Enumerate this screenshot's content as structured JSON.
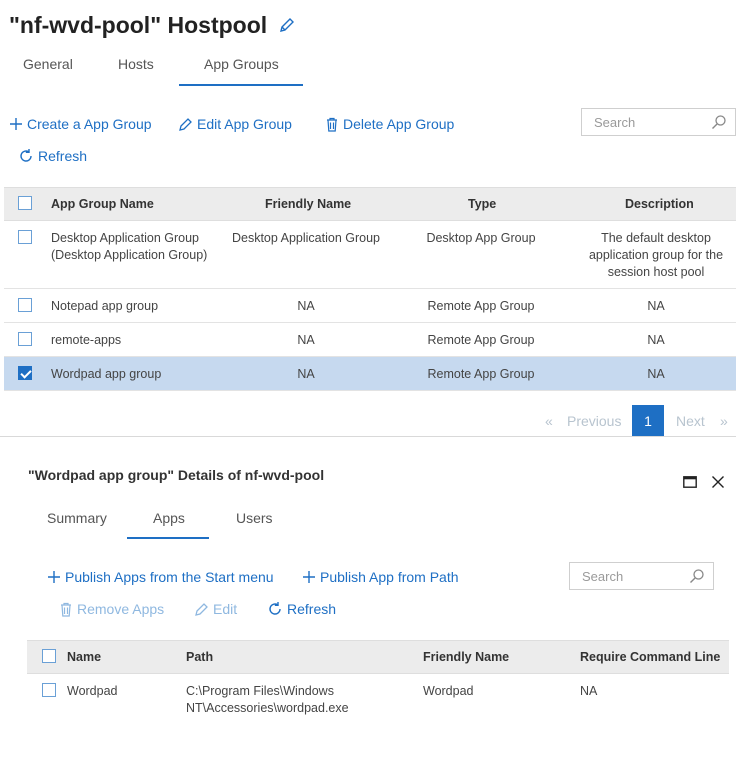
{
  "header": {
    "title": "\"nf-wvd-pool\" Hostpool"
  },
  "tabs": [
    {
      "label": "General",
      "active": false
    },
    {
      "label": "Hosts",
      "active": false
    },
    {
      "label": "App Groups",
      "active": true
    }
  ],
  "toolbar": {
    "create_label": "Create a App Group",
    "edit_label": "Edit App Group",
    "delete_label": "Delete App Group",
    "refresh_label": "Refresh",
    "search_placeholder": "Search"
  },
  "app_groups_table": {
    "columns": [
      "App Group Name",
      "Friendly Name",
      "Type",
      "Description"
    ],
    "rows": [
      {
        "name_line1": "Desktop Application Group",
        "name_line2": "(Desktop Application Group)",
        "friendly_name": "Desktop Application Group",
        "type": "Desktop App Group",
        "desc_line1": "The default desktop",
        "desc_line2": "application group for the",
        "desc_line3": "session host pool",
        "selected": false
      },
      {
        "name": "Notepad app group",
        "friendly_name": "NA",
        "type": "Remote App Group",
        "description": "NA",
        "selected": false
      },
      {
        "name": "remote-apps",
        "friendly_name": "NA",
        "type": "Remote App Group",
        "description": "NA",
        "selected": false
      },
      {
        "name": "Wordpad app group",
        "friendly_name": "NA",
        "type": "Remote App Group",
        "description": "NA",
        "selected": true
      }
    ]
  },
  "pager": {
    "prev_label": "Previous",
    "current_page": "1",
    "next_label": "Next",
    "prev_arrow": "«",
    "next_arrow": "»"
  },
  "details": {
    "title": "\"Wordpad app group\" Details of nf-wvd-pool",
    "tabs": [
      {
        "label": "Summary",
        "active": false
      },
      {
        "label": "Apps",
        "active": true
      },
      {
        "label": "Users",
        "active": false
      }
    ],
    "toolbar": {
      "publish_start_label": "Publish Apps from the Start menu",
      "publish_path_label": "Publish App from Path",
      "remove_label": "Remove Apps",
      "edit_label": "Edit",
      "refresh_label": "Refresh",
      "search_placeholder": "Search"
    },
    "apps_table": {
      "columns": [
        "Name",
        "Path",
        "Friendly Name",
        "Require Command Line"
      ],
      "rows": [
        {
          "name": "Wordpad",
          "path_line1": "C:\\Program Files\\Windows",
          "path_line2": "NT\\Accessories\\wordpad.exe",
          "friendly_name": "Wordpad",
          "require_command_line": "NA"
        }
      ]
    }
  },
  "colors": {
    "accent": "#1e6fc4",
    "selected_row": "#c6d9ef",
    "header_bg": "#ececec"
  }
}
